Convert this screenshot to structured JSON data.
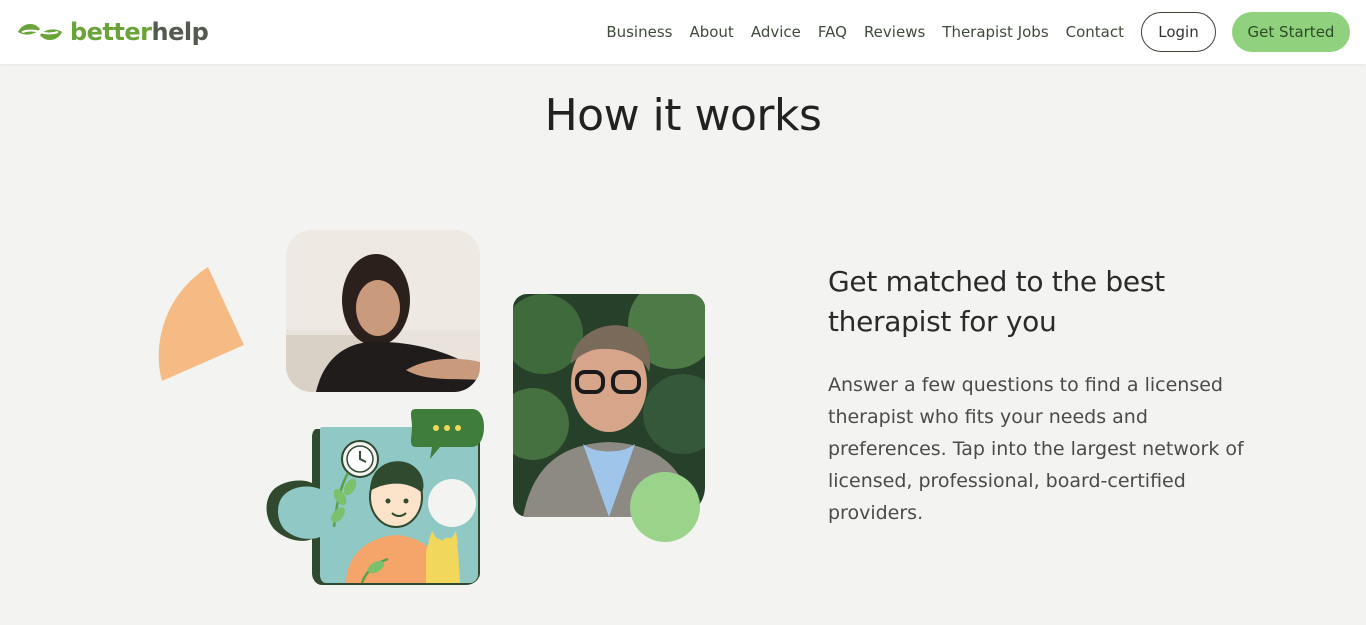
{
  "brand": {
    "name_part1": "better",
    "name_part2": "help"
  },
  "nav": {
    "links": [
      "Business",
      "About",
      "Advice",
      "FAQ",
      "Reviews",
      "Therapist Jobs",
      "Contact"
    ],
    "login_label": "Login",
    "get_started_label": "Get Started"
  },
  "main": {
    "title": "How it works",
    "step": {
      "heading": "Get matched to the best therapist for you",
      "body": "Answer a few questions to find a licensed therapist who fits your needs and preferences. Tap into the largest network of licensed, professional, board-certified providers."
    }
  },
  "colors": {
    "brand_green": "#6aa33a",
    "cta_green": "#8fd17c",
    "accent_orange": "#f6bb84",
    "page_bg": "#f3f4f1"
  }
}
